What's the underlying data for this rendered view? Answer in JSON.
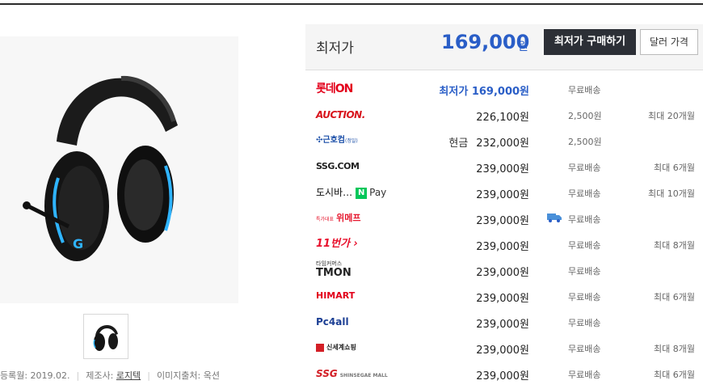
{
  "product": {
    "thumbnail_count": 1,
    "meta": {
      "reg_label": "등록월: 2019.02.",
      "maker_prefix": "제조사:",
      "maker": "로지텍",
      "image_source": "이미지출처: 옥션"
    }
  },
  "summary": {
    "label": "최저가",
    "lowest_price": "169,000",
    "currency": "원",
    "buy_button": "최저가 구매하기",
    "usd_button": "달러 가격"
  },
  "colors": {
    "accent_blue": "#2a5ec7",
    "dark_button": "#2c2f36",
    "header_bg": "#f5f5f5"
  },
  "offers": [
    {
      "shop": "롯데ON",
      "price": "최저가 169,000원",
      "best": true,
      "shipping": "무료배송",
      "installment": ""
    },
    {
      "shop": "AUCTION.",
      "price": "226,100원",
      "shipping": "2,500원",
      "installment": "최대 20개월"
    },
    {
      "shop": "근호컴",
      "shop_sub": "(정일)",
      "cash": "현금",
      "price": "232,000원",
      "shipping": "2,500원",
      "installment": ""
    },
    {
      "shop": "SSG.COM",
      "price": "239,000원",
      "shipping": "무료배송",
      "installment": "최대 6개월"
    },
    {
      "shop": "도시바…",
      "npay": "N",
      "npay_text": "Pay",
      "price": "239,000원",
      "shipping": "무료배송",
      "installment": "최대 10개월"
    },
    {
      "shop": "위메프",
      "shop_sub": "특가대표",
      "price": "239,000원",
      "shipping": "무료배송",
      "truck_icon": "delivery-truck-icon",
      "installment": ""
    },
    {
      "shop": "11번가",
      "price": "239,000원",
      "shipping": "무료배송",
      "installment": "최대 8개월"
    },
    {
      "shop": "TMON",
      "shop_sub": "타임커머스",
      "price": "239,000원",
      "shipping": "무료배송",
      "installment": ""
    },
    {
      "shop": "HIMART",
      "price": "239,000원",
      "shipping": "무료배송",
      "installment": "최대 6개월"
    },
    {
      "shop": "Pc4all",
      "price": "239,000원",
      "shipping": "무료배송",
      "installment": ""
    },
    {
      "shop": "신세계쇼핑",
      "price": "239,000원",
      "shipping": "무료배송",
      "installment": "최대 8개월"
    },
    {
      "shop": "SSG",
      "shop_sub": "SHINSEGAE MALL",
      "price": "239,000원",
      "shipping": "무료배송",
      "installment": "최대 6개월"
    }
  ]
}
